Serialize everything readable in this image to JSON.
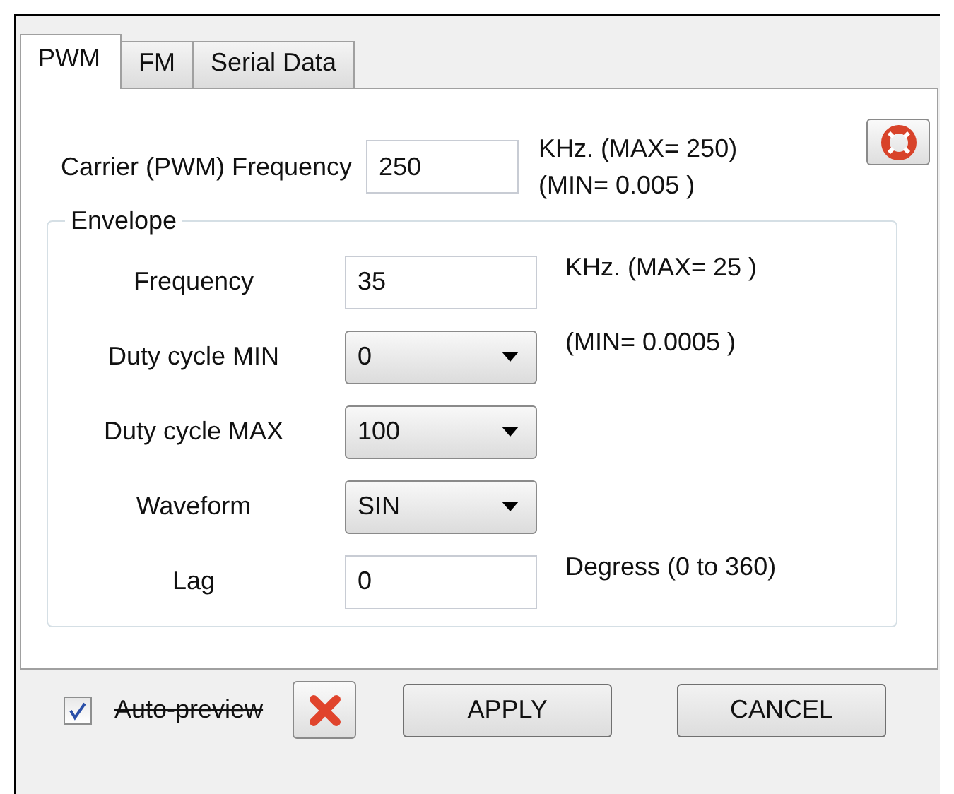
{
  "tabs": [
    {
      "label": "PWM",
      "selected": true
    },
    {
      "label": "FM",
      "selected": false
    },
    {
      "label": "Serial Data",
      "selected": false
    }
  ],
  "carrier": {
    "label": "Carrier (PWM) Frequency",
    "value": "250",
    "notes": [
      "KHz. (MAX= 250)",
      "(MIN= 0.005 )"
    ]
  },
  "envelope": {
    "title": "Envelope",
    "rows": [
      {
        "kind": "input",
        "label": "Frequency",
        "value": "35",
        "note": "KHz. (MAX= 25 )"
      },
      {
        "kind": "select",
        "label": "Duty cycle MIN",
        "value": "0",
        "note": "(MIN= 0.0005 )"
      },
      {
        "kind": "select",
        "label": "Duty cycle MAX",
        "value": "100"
      },
      {
        "kind": "select",
        "label": "Waveform",
        "value": "SIN"
      },
      {
        "kind": "input",
        "label": "Lag",
        "value": "0",
        "note": "Degress (0 to 360)"
      }
    ]
  },
  "auto_preview": {
    "label": "Auto-preview",
    "checked": true,
    "struck": true
  },
  "buttons": [
    "APPLY",
    "CANCEL"
  ]
}
